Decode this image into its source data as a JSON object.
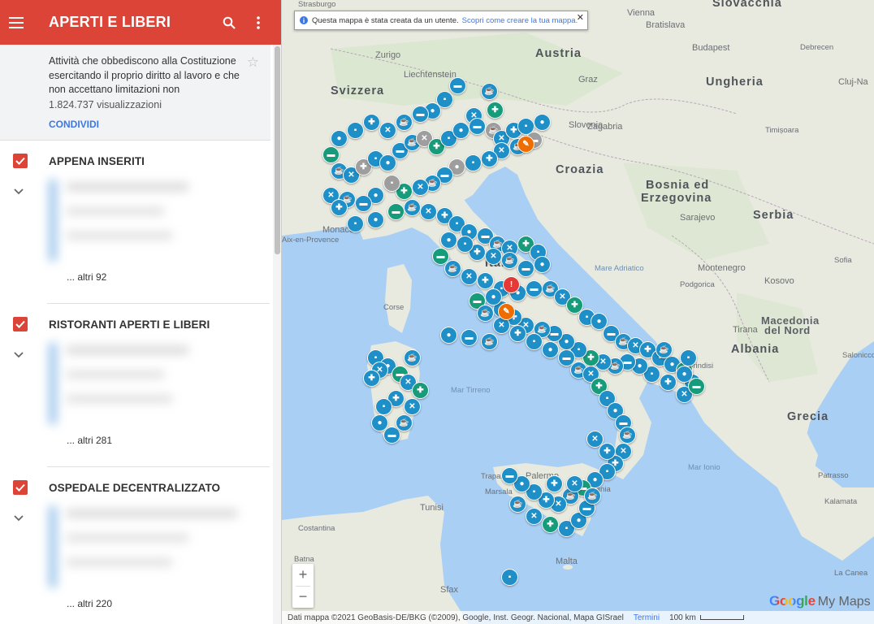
{
  "appbar": {
    "title": "APERTI E LIBERI",
    "menu_icon": "menu-icon",
    "search_icon": "search-icon",
    "more_icon": "more-vert-icon"
  },
  "description": {
    "text": "Attività che obbediscono alla Costituzione esercitando il proprio diritto al lavoro e che non accettano limitazioni non",
    "views": "1.824.737 visualizzazioni",
    "share": "CONDIVIDI"
  },
  "layers": [
    {
      "name": "APPENA INSERITI",
      "more": "... altri 92"
    },
    {
      "name": "RISTORANTI APERTI E LIBERI",
      "more": "... altri 281"
    },
    {
      "name": "OSPEDALE DECENTRALIZZATO",
      "more": "... altri 220"
    }
  ],
  "notice": {
    "text": "Questa mappa è stata creata da un utente.",
    "link": "Scopri come creare la tua mappa."
  },
  "map_labels": [
    {
      "text": "Slovacchia",
      "cls": "big"
    },
    {
      "text": "Vienna",
      "cls": "small"
    },
    {
      "text": "Bratislava",
      "cls": "small"
    },
    {
      "text": "Strasburgo",
      "cls": "tiny"
    },
    {
      "text": "Zurigo",
      "cls": "small"
    },
    {
      "text": "Austria",
      "cls": "big"
    },
    {
      "text": "Budapest",
      "cls": "small"
    },
    {
      "text": "Debrecen",
      "cls": "tiny"
    },
    {
      "text": "Cluj-Na",
      "cls": "small"
    },
    {
      "text": "Svizzera",
      "cls": "big"
    },
    {
      "text": "Liechtenstein",
      "cls": "small"
    },
    {
      "text": "Graz",
      "cls": "small"
    },
    {
      "text": "Ungheria",
      "cls": "big"
    },
    {
      "text": "Slovenia",
      "cls": "small"
    },
    {
      "text": "Zagabria",
      "cls": "small"
    },
    {
      "text": "Timișoara",
      "cls": "tiny"
    },
    {
      "text": "Croazia",
      "cls": "big"
    },
    {
      "text": "Bosnia ed",
      "cls": "big"
    },
    {
      "text": "Erzegovina",
      "cls": "big"
    },
    {
      "text": "Serbia",
      "cls": "big"
    },
    {
      "text": "Sarajevo",
      "cls": "small"
    },
    {
      "text": "Monaco",
      "cls": "small"
    },
    {
      "text": "Aix-en-Provence",
      "cls": "tiny"
    },
    {
      "text": "Italia",
      "cls": "big"
    },
    {
      "text": "Montenegro",
      "cls": "small"
    },
    {
      "text": "Kosovo",
      "cls": "small"
    },
    {
      "text": "Sofia",
      "cls": "tiny"
    },
    {
      "text": "Corse",
      "cls": "tiny"
    },
    {
      "text": "Mare Adriatico",
      "cls": "sea"
    },
    {
      "text": "Podgorica",
      "cls": "tiny"
    },
    {
      "text": "Tirana",
      "cls": "small"
    },
    {
      "text": "Macedonia",
      "cls": "mid"
    },
    {
      "text": "del Nord",
      "cls": "mid"
    },
    {
      "text": "Albania",
      "cls": "big"
    },
    {
      "text": "Salonicco",
      "cls": "tiny"
    },
    {
      "text": "Mar Tirreno",
      "cls": "sea"
    },
    {
      "text": "Grecia",
      "cls": "big"
    },
    {
      "text": "Mar Ionio",
      "cls": "sea"
    },
    {
      "text": "Palermo",
      "cls": "small"
    },
    {
      "text": "Trapani",
      "cls": "tiny"
    },
    {
      "text": "Marsala",
      "cls": "tiny"
    },
    {
      "text": "Catania",
      "cls": "tiny"
    },
    {
      "text": "Tunisi",
      "cls": "small"
    },
    {
      "text": "Costantina",
      "cls": "tiny"
    },
    {
      "text": "Batna",
      "cls": "tiny"
    },
    {
      "text": "Malta",
      "cls": "small"
    },
    {
      "text": "Sfax",
      "cls": "small"
    },
    {
      "text": "Patrasso",
      "cls": "tiny"
    },
    {
      "text": "Kalamata",
      "cls": "tiny"
    },
    {
      "text": "La Canea",
      "cls": "tiny"
    },
    {
      "text": "Brindisi",
      "cls": "tiny"
    }
  ],
  "pin_groups": [
    {
      "name": "pin-blue",
      "color": "#1f8fc7"
    },
    {
      "name": "pin-green",
      "color": "#169c7a"
    },
    {
      "name": "pin-grey",
      "color": "#9e9e9e"
    }
  ],
  "pin_icons": [
    "bed-icon",
    "cafe-icon",
    "restaurant-icon",
    "cross-icon",
    "shop-icon",
    "dot-icon"
  ],
  "zoom": {
    "in": "+",
    "out": "−"
  },
  "logo": {
    "google": "Google",
    "mymaps": "My Maps"
  },
  "footer": {
    "attribution": "Dati mappa ©2021 GeoBasis-DE/BKG (©2009), Google, Inst. Geogr. Nacional, Mapa GISrael",
    "terms": "Termini",
    "scale": "100 km"
  }
}
